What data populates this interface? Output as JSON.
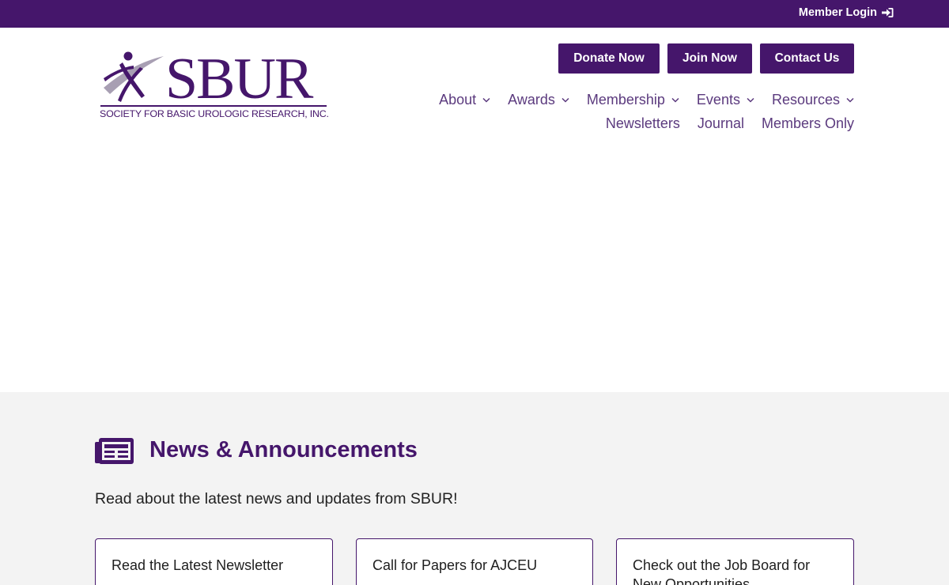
{
  "topbar": {
    "member_login_label": "Member Login",
    "icon": "sign-in-icon"
  },
  "logo": {
    "wordmark": "SBUR",
    "tagline": "SOCIETY FOR BASIC UROLOGIC RESEARCH, INC."
  },
  "header_buttons": {
    "donate": "Donate Now",
    "join": "Join Now",
    "contact": "Contact Us"
  },
  "nav": {
    "row1": [
      {
        "label": "About",
        "has_dropdown": true
      },
      {
        "label": "Awards",
        "has_dropdown": true
      },
      {
        "label": "Membership",
        "has_dropdown": true
      },
      {
        "label": "Events",
        "has_dropdown": true
      },
      {
        "label": "Resources",
        "has_dropdown": true
      }
    ],
    "row2": [
      {
        "label": "Newsletters"
      },
      {
        "label": "Journal"
      },
      {
        "label": "Members Only"
      }
    ]
  },
  "news": {
    "icon": "newspaper-icon",
    "title": "News & Announcements",
    "subtitle": "Read about the latest news and updates from SBUR!",
    "cards": [
      {
        "title": "Read the Latest Newsletter"
      },
      {
        "title": "Call for Papers for AJCEU"
      },
      {
        "title": "Check out the Job Board for New Opportunities"
      }
    ]
  },
  "colors": {
    "brand_purple": "#45166b",
    "nav_text": "#5b3a7e",
    "news_bg": "#f3f3f3"
  }
}
